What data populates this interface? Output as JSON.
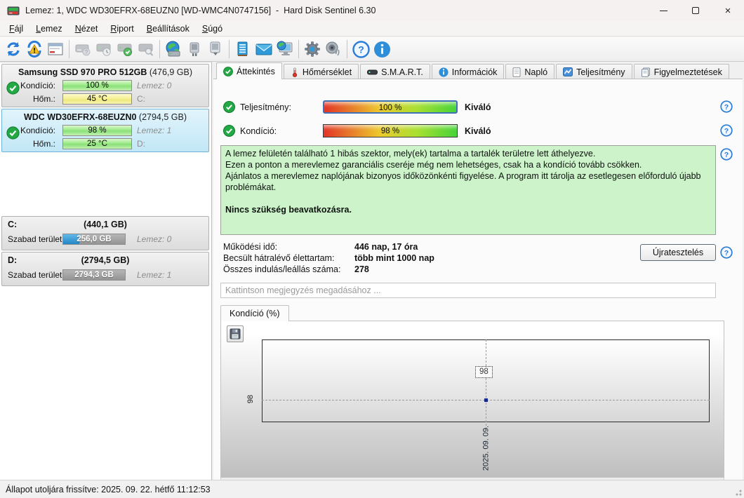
{
  "window": {
    "title": "Lemez: 1, WDC WD30EFRX-68EUZN0 [WD-WMC4N0747156]  -  Hard Disk Sentinel 6.30"
  },
  "menu": {
    "items": [
      {
        "label": "Fájl",
        "accel": "F"
      },
      {
        "label": "Lemez",
        "accel": "L"
      },
      {
        "label": "Nézet",
        "accel": "N"
      },
      {
        "label": "Riport",
        "accel": "R"
      },
      {
        "label": "Beállítások",
        "accel": "B"
      },
      {
        "label": "Súgó",
        "accel": "S"
      }
    ]
  },
  "toolbar": {
    "buttons": [
      "refresh",
      "refresh-warning",
      "report-window",
      "disk-question",
      "disk-clock",
      "disk-check",
      "disk-search",
      "network-disk",
      "disk-connect",
      "disk-eject",
      "notes",
      "email",
      "remote-monitor",
      "settings-gear",
      "sound-speaker",
      "help",
      "info"
    ]
  },
  "sidebar": {
    "disks": [
      {
        "name": "Samsung SSD 970 PRO 512GB",
        "size": "(476,9 GB)",
        "condition_label": "Kondíció:",
        "condition_value": "100 %",
        "temp_label": "Hőm.:",
        "temp_value": "45 °C",
        "disk_index": "Lemez: 0",
        "drive": "C:"
      },
      {
        "name": "WDC WD30EFRX-68EUZN0",
        "size": "(2794,5 GB)",
        "condition_label": "Kondíció:",
        "condition_value": "98 %",
        "temp_label": "Hőm.:",
        "temp_value": "25 °C",
        "disk_index": "Lemez: 1",
        "drive": "D:"
      }
    ],
    "volumes": [
      {
        "drive": "C:",
        "size": "(440,1 GB)",
        "free_label": "Szabad terület",
        "free_value": "256,0 GB",
        "fill_pct": 26,
        "disk_index": "Lemez: 0"
      },
      {
        "drive": "D:",
        "size": "(2794,5 GB)",
        "free_label": "Szabad terület",
        "free_value": "2794,3 GB",
        "fill_pct": 0,
        "disk_index": "Lemez: 1"
      }
    ]
  },
  "tabs": [
    {
      "label": "Áttekintés"
    },
    {
      "label": "Hőmérséklet"
    },
    {
      "label": "S.M.A.R.T."
    },
    {
      "label": "Információk"
    },
    {
      "label": "Napló"
    },
    {
      "label": "Teljesítmény"
    },
    {
      "label": "Figyelmeztetések"
    }
  ],
  "overview": {
    "performance": {
      "label": "Teljesítmény:",
      "value": "100 %",
      "pct": 100,
      "rating": "Kiváló"
    },
    "condition": {
      "label": "Kondíció:",
      "value": "98 %",
      "pct": 98,
      "rating": "Kiváló"
    },
    "message": {
      "lines": [
        "A lemez felületén található 1 hibás szektor, mely(ek) tartalma a tartalék területre lett áthelyezve.",
        "Ezen a ponton a merevlemez garanciális cseréje még nem lehetséges, csak ha a kondíció tovább csökken.",
        "Ajánlatos a merevlemez naplójának bizonyos időközönkénti figyelése. A program itt tárolja az esetlegesen előforduló újabb problémákat."
      ],
      "action": "Nincs szükség beavatkozásra."
    },
    "stats": [
      {
        "label": "Működési idő:",
        "value": "446 nap, 17 óra"
      },
      {
        "label": "Becsült hátralévő élettartam:",
        "value": "több mint 1000 nap"
      },
      {
        "label": "Összes indulás/leállás száma:",
        "value": "278"
      }
    ],
    "retest_button": "Újratesztelés",
    "comment_placeholder": "Kattintson megjegyzés megadásához ..."
  },
  "chart_data": {
    "type": "line",
    "title": "Kondíció  (%)",
    "x": [
      "2025. 09. 09."
    ],
    "values": [
      98
    ],
    "point_label": "98",
    "y_tick": "98",
    "x_tick": "2025. 09. 09.",
    "grid": "dashed-crosshair",
    "point_color": "#142a8c"
  },
  "statusbar": {
    "text": "Állapot utoljára frissítve: 2025. 09. 22. hétfő 11:12:53"
  },
  "colors": {
    "accent_blue": "#2b7cd6",
    "ok_green": "#1fa33c",
    "panel_selected": "#cfe9f7",
    "message_bg": "#cdf3cb",
    "gauge_gradient": [
      "#e23326",
      "#ecc92e",
      "#46d338"
    ],
    "free_fill_blue": "#2286c4",
    "temp_warm_yellow": "#f4ef90",
    "bar_green": "#97e884"
  }
}
